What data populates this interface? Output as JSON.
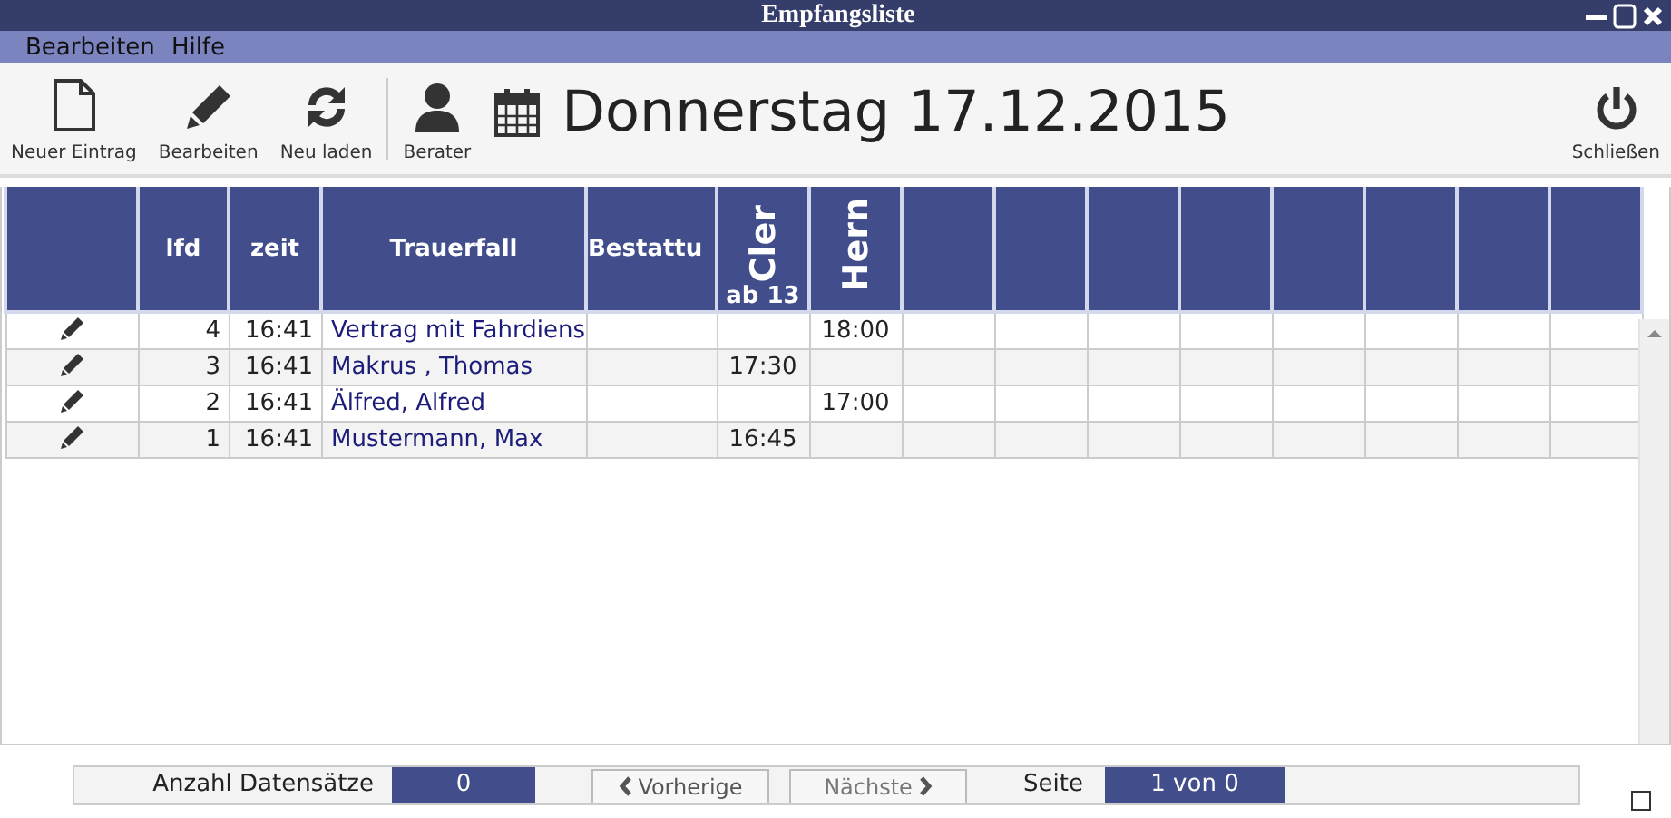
{
  "window": {
    "title": "Empfangsliste"
  },
  "menu": [
    "Bearbeiten",
    "Hilfe"
  ],
  "toolbar": {
    "buttons": [
      {
        "label": "Neuer Eintrag",
        "kind": "file"
      },
      {
        "label": "Bearbeiten",
        "kind": "pencil"
      },
      {
        "label": "Neu laden",
        "kind": "refresh"
      },
      {
        "label": "Berater",
        "kind": "person"
      }
    ],
    "date": "Donnerstag 17.12.2015",
    "close": "Schließen"
  },
  "table": {
    "columns": [
      {
        "kind": "edit"
      },
      {
        "label": "lfd",
        "kind": "num"
      },
      {
        "label": "zeit",
        "kind": "time"
      },
      {
        "label": "Trauerfall",
        "kind": "name"
      },
      {
        "label": "Bestattu",
        "kind": "text"
      },
      {
        "label": "Cler",
        "sub": "ab 13",
        "kind": "vertical"
      },
      {
        "label": "Hern",
        "kind": "vertical"
      },
      {
        "kind": "blank"
      },
      {
        "kind": "blank"
      },
      {
        "kind": "blank"
      },
      {
        "kind": "blank"
      },
      {
        "kind": "blank"
      },
      {
        "kind": "blank"
      },
      {
        "kind": "blank"
      },
      {
        "kind": "blank"
      }
    ],
    "rows": [
      {
        "lfd": "4",
        "zeit": "16:41",
        "trauerfall": "Vertrag mit Fahrdiens",
        "column_7": "18:00"
      },
      {
        "lfd": "3",
        "zeit": "16:41",
        "trauerfall": "Makrus , Thomas",
        "column_6": "17:30"
      },
      {
        "lfd": "2",
        "zeit": "16:41",
        "trauerfall": "Älfred, Alfred",
        "column_7": "17:00"
      },
      {
        "lfd": "1",
        "zeit": "16:41",
        "trauerfall": "Mustermann, Max",
        "column_6": "16:45"
      }
    ]
  },
  "pager": {
    "count_label": "Anzahl Datensätze",
    "count": "0",
    "previous": "Vorherige",
    "next": "Nächste",
    "page_label": "Seite",
    "page": "1 von 0",
    "checked": false
  }
}
